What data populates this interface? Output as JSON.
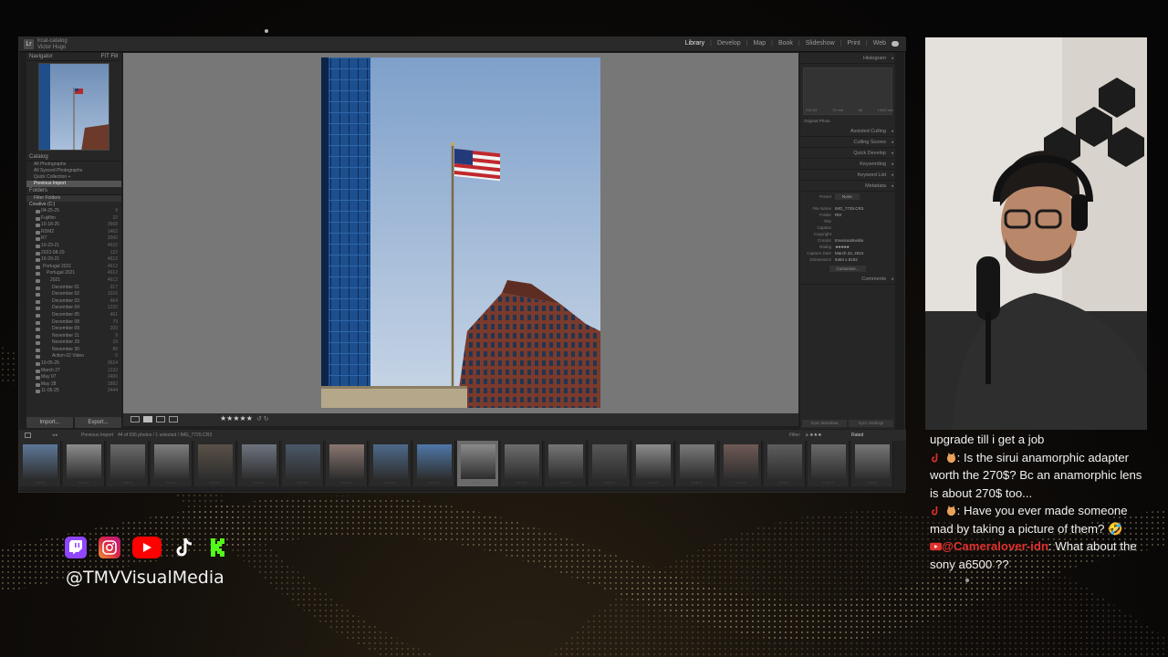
{
  "lightroom": {
    "catalog_label": "lrcat-catalog",
    "user": "Victor Hugo",
    "modules": [
      "Library",
      "Develop",
      "Map",
      "Book",
      "Slideshow",
      "Print",
      "Web"
    ],
    "active_module": "Library",
    "left_panel": {
      "navigator": "Navigator",
      "navigator_zoom": "FIT  Fill",
      "catalog": "Catalog",
      "catalog_items": [
        "All Photographs",
        "All Synced Photographs",
        "Quick Collection +",
        "Previous Import"
      ],
      "folders": "Folders",
      "filter_folders": "Filter Folders",
      "drive": "Creative (C:)",
      "folder_list": [
        {
          "name": "04-25-25",
          "count": "9"
        },
        {
          "name": "Fujifilm",
          "count": "22"
        },
        {
          "name": "10-18-25",
          "count": "3668"
        },
        {
          "name": "RDM2",
          "count": "1462"
        },
        {
          "name": "R7",
          "count": "2000"
        },
        {
          "name": "10-23-21",
          "count": "4632"
        },
        {
          "name": "2022-08-20",
          "count": "122"
        },
        {
          "name": "10-29-21",
          "count": "4612"
        },
        {
          "name": "Portugal 2021",
          "count": "4612"
        },
        {
          "name": "Portugal 2021",
          "count": "4612"
        },
        {
          "name": "2021",
          "count": "4612"
        },
        {
          "name": "December 01",
          "count": "317"
        },
        {
          "name": "December 02",
          "count": "1016"
        },
        {
          "name": "December 03",
          "count": "464"
        },
        {
          "name": "December 04",
          "count": "1220"
        },
        {
          "name": "December 05",
          "count": "461"
        },
        {
          "name": "December 08",
          "count": "79"
        },
        {
          "name": "December 09",
          "count": "200"
        },
        {
          "name": "November 11",
          "count": "9"
        },
        {
          "name": "November 29",
          "count": "19"
        },
        {
          "name": "November 30",
          "count": "89"
        },
        {
          "name": "Action 02 Video",
          "count": "0"
        },
        {
          "name": "10-05-25",
          "count": "3624"
        },
        {
          "name": "March 27",
          "count": "1232"
        },
        {
          "name": "May 07",
          "count": "2400"
        },
        {
          "name": "May 28",
          "count": "1882"
        },
        {
          "name": "11-05-25",
          "count": "2444"
        }
      ],
      "import_label": "Import...",
      "export_label": "Export..."
    },
    "right_panel": {
      "histogram": "Histogram",
      "histo_info": [
        "ISO 64",
        "70 mm",
        "f/8",
        "1/640 sec"
      ],
      "original_photo": "Original Photo",
      "assisted_culling": "Assisted Culling",
      "culling_scores": "Culling Scores",
      "quick_develop": "Quick Develop",
      "keywording": "Keywording",
      "keyword_list": "Keyword List",
      "metadata": "Metadata",
      "preset_label": "Preset",
      "preset_value": "None",
      "metadata_rows": [
        {
          "k": "File Name",
          "v": "IMG_7725.CR3"
        },
        {
          "k": "Folder",
          "v": "RM"
        },
        {
          "k": "Title",
          "v": ""
        },
        {
          "k": "Caption",
          "v": ""
        },
        {
          "k": "Copyright",
          "v": ""
        },
        {
          "k": "Creator",
          "v": "tmvvisualmedia"
        },
        {
          "k": "Rating",
          "v": "★★★★★"
        },
        {
          "k": "Capture Date",
          "v": "March 24, 2024"
        },
        {
          "k": "Dimensions",
          "v": "5464 x 8192"
        }
      ],
      "customize": "Customize...",
      "comments": "Comments",
      "sync_meta": "Sync Metadata",
      "sync_settings": "Sync Settings"
    },
    "toolbar": {
      "stars": "★★★★★"
    },
    "filmstrip": {
      "source": "Previous Import",
      "info": "44 of 936 photos / 1 selected / IMG_7725.CR3",
      "filter_label": "Filter:",
      "filter_value": "Rated"
    }
  },
  "chat": {
    "messages": [
      {
        "user": "",
        "text": "upgrade till i get a job"
      },
      {
        "user": "",
        "text": ": Is the sirui anamorphic adapter worth the 270$? Bc an anamorphic lens is about 270$ too..."
      },
      {
        "user": "",
        "text": ": Have you ever made someone mad by taking a picture of them? 🤣"
      },
      {
        "user": "@Cameralover-idn",
        "text": ": What about the sony a6500 ??"
      }
    ]
  },
  "socials": {
    "handle": "@TMVVisualMedia",
    "icons": [
      "twitch-icon",
      "instagram-icon",
      "youtube-icon",
      "tiktok-icon",
      "kick-icon"
    ],
    "colors": {
      "twitch": "#9146ff",
      "instagram": "#d6336c",
      "youtube": "#ff0000",
      "tiktok": "#ffffff",
      "kick": "#53fc18"
    }
  }
}
